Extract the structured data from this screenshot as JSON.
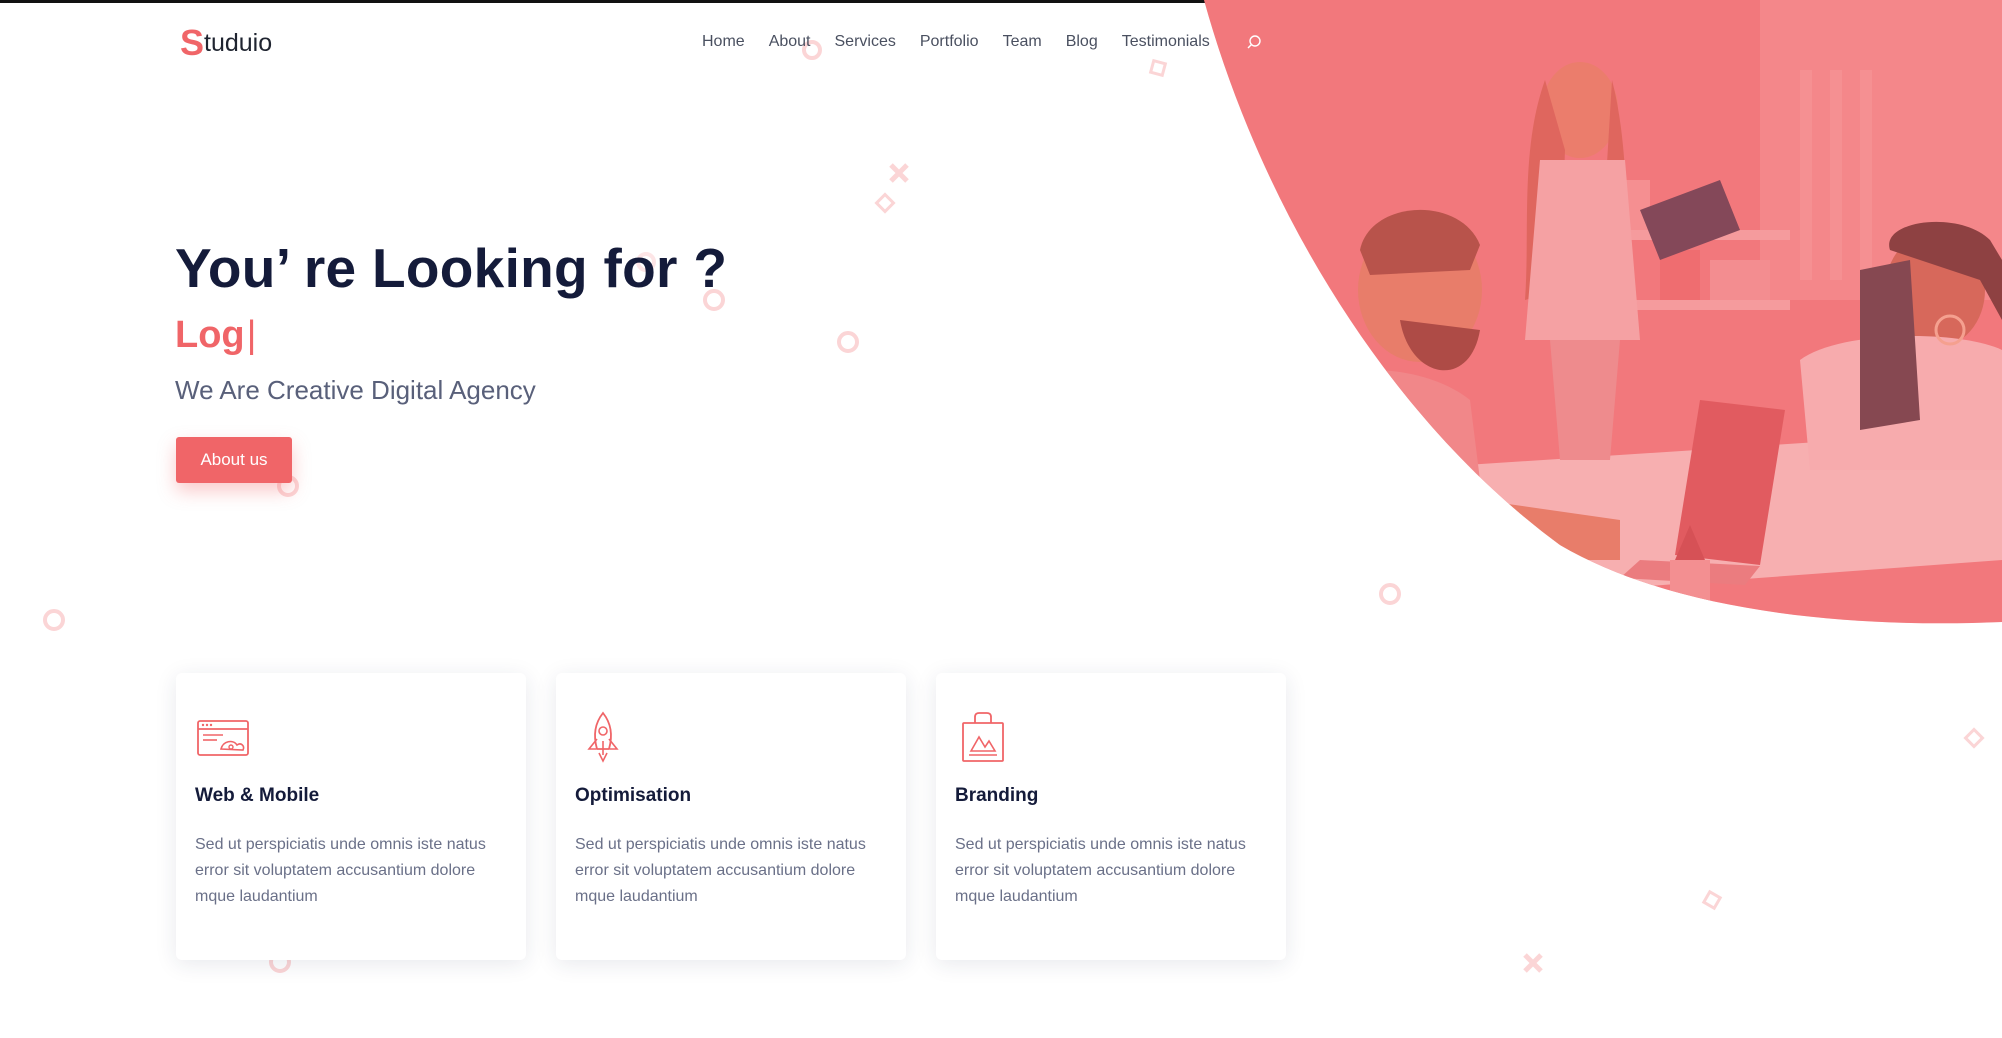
{
  "brand": {
    "logo_initial": "S",
    "logo_rest": "tuduio",
    "accent_color": "#f06568",
    "dark_color": "#141b3a"
  },
  "nav": {
    "items": [
      {
        "label": "Home"
      },
      {
        "label": "About"
      },
      {
        "label": "Services"
      },
      {
        "label": "Portfolio"
      },
      {
        "label": "Team"
      },
      {
        "label": "Blog"
      },
      {
        "label": "Testimonials"
      }
    ],
    "search_icon": "search-icon"
  },
  "hero": {
    "title": "You’ re Looking for ?",
    "typed_text": "Log",
    "cursor": "|",
    "subtitle": "We Are Creative Digital Agency",
    "button_label": "About us",
    "image": "office-team-photo-with-coral-overlay"
  },
  "services": [
    {
      "icon": "browser-window-icon",
      "title": "Web & Mobile",
      "text": "Sed ut perspiciatis unde omnis iste natus error sit voluptatem accusantium dolore mque laudantium"
    },
    {
      "icon": "rocket-icon",
      "title": "Optimisation",
      "text": "Sed ut perspiciatis unde omnis iste natus error sit voluptatem accusantium dolore mque laudantium"
    },
    {
      "icon": "shopping-bag-icon",
      "title": "Branding",
      "text": "Sed ut perspiciatis unde omnis iste natus error sit voluptatem accusantium dolore mque laudantium"
    }
  ]
}
